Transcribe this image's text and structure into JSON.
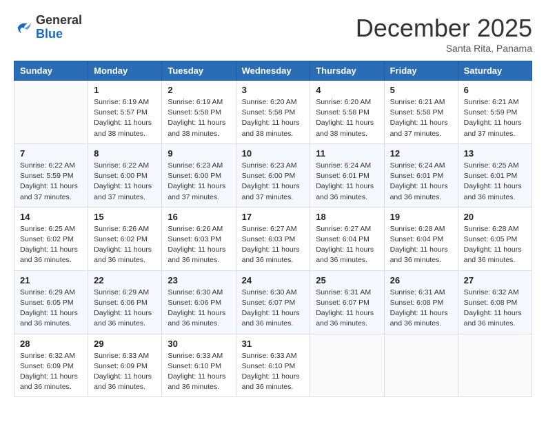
{
  "header": {
    "logo_line1": "General",
    "logo_line2": "Blue",
    "month_title": "December 2025",
    "subtitle": "Santa Rita, Panama"
  },
  "weekdays": [
    "Sunday",
    "Monday",
    "Tuesday",
    "Wednesday",
    "Thursday",
    "Friday",
    "Saturday"
  ],
  "weeks": [
    [
      {
        "day": "",
        "info": ""
      },
      {
        "day": "1",
        "info": "Sunrise: 6:19 AM\nSunset: 5:57 PM\nDaylight: 11 hours and 38 minutes."
      },
      {
        "day": "2",
        "info": "Sunrise: 6:19 AM\nSunset: 5:58 PM\nDaylight: 11 hours and 38 minutes."
      },
      {
        "day": "3",
        "info": "Sunrise: 6:20 AM\nSunset: 5:58 PM\nDaylight: 11 hours and 38 minutes."
      },
      {
        "day": "4",
        "info": "Sunrise: 6:20 AM\nSunset: 5:58 PM\nDaylight: 11 hours and 38 minutes."
      },
      {
        "day": "5",
        "info": "Sunrise: 6:21 AM\nSunset: 5:58 PM\nDaylight: 11 hours and 37 minutes."
      },
      {
        "day": "6",
        "info": "Sunrise: 6:21 AM\nSunset: 5:59 PM\nDaylight: 11 hours and 37 minutes."
      }
    ],
    [
      {
        "day": "7",
        "info": "Sunrise: 6:22 AM\nSunset: 5:59 PM\nDaylight: 11 hours and 37 minutes."
      },
      {
        "day": "8",
        "info": "Sunrise: 6:22 AM\nSunset: 6:00 PM\nDaylight: 11 hours and 37 minutes."
      },
      {
        "day": "9",
        "info": "Sunrise: 6:23 AM\nSunset: 6:00 PM\nDaylight: 11 hours and 37 minutes."
      },
      {
        "day": "10",
        "info": "Sunrise: 6:23 AM\nSunset: 6:00 PM\nDaylight: 11 hours and 37 minutes."
      },
      {
        "day": "11",
        "info": "Sunrise: 6:24 AM\nSunset: 6:01 PM\nDaylight: 11 hours and 36 minutes."
      },
      {
        "day": "12",
        "info": "Sunrise: 6:24 AM\nSunset: 6:01 PM\nDaylight: 11 hours and 36 minutes."
      },
      {
        "day": "13",
        "info": "Sunrise: 6:25 AM\nSunset: 6:01 PM\nDaylight: 11 hours and 36 minutes."
      }
    ],
    [
      {
        "day": "14",
        "info": "Sunrise: 6:25 AM\nSunset: 6:02 PM\nDaylight: 11 hours and 36 minutes."
      },
      {
        "day": "15",
        "info": "Sunrise: 6:26 AM\nSunset: 6:02 PM\nDaylight: 11 hours and 36 minutes."
      },
      {
        "day": "16",
        "info": "Sunrise: 6:26 AM\nSunset: 6:03 PM\nDaylight: 11 hours and 36 minutes."
      },
      {
        "day": "17",
        "info": "Sunrise: 6:27 AM\nSunset: 6:03 PM\nDaylight: 11 hours and 36 minutes."
      },
      {
        "day": "18",
        "info": "Sunrise: 6:27 AM\nSunset: 6:04 PM\nDaylight: 11 hours and 36 minutes."
      },
      {
        "day": "19",
        "info": "Sunrise: 6:28 AM\nSunset: 6:04 PM\nDaylight: 11 hours and 36 minutes."
      },
      {
        "day": "20",
        "info": "Sunrise: 6:28 AM\nSunset: 6:05 PM\nDaylight: 11 hours and 36 minutes."
      }
    ],
    [
      {
        "day": "21",
        "info": "Sunrise: 6:29 AM\nSunset: 6:05 PM\nDaylight: 11 hours and 36 minutes."
      },
      {
        "day": "22",
        "info": "Sunrise: 6:29 AM\nSunset: 6:06 PM\nDaylight: 11 hours and 36 minutes."
      },
      {
        "day": "23",
        "info": "Sunrise: 6:30 AM\nSunset: 6:06 PM\nDaylight: 11 hours and 36 minutes."
      },
      {
        "day": "24",
        "info": "Sunrise: 6:30 AM\nSunset: 6:07 PM\nDaylight: 11 hours and 36 minutes."
      },
      {
        "day": "25",
        "info": "Sunrise: 6:31 AM\nSunset: 6:07 PM\nDaylight: 11 hours and 36 minutes."
      },
      {
        "day": "26",
        "info": "Sunrise: 6:31 AM\nSunset: 6:08 PM\nDaylight: 11 hours and 36 minutes."
      },
      {
        "day": "27",
        "info": "Sunrise: 6:32 AM\nSunset: 6:08 PM\nDaylight: 11 hours and 36 minutes."
      }
    ],
    [
      {
        "day": "28",
        "info": "Sunrise: 6:32 AM\nSunset: 6:09 PM\nDaylight: 11 hours and 36 minutes."
      },
      {
        "day": "29",
        "info": "Sunrise: 6:33 AM\nSunset: 6:09 PM\nDaylight: 11 hours and 36 minutes."
      },
      {
        "day": "30",
        "info": "Sunrise: 6:33 AM\nSunset: 6:10 PM\nDaylight: 11 hours and 36 minutes."
      },
      {
        "day": "31",
        "info": "Sunrise: 6:33 AM\nSunset: 6:10 PM\nDaylight: 11 hours and 36 minutes."
      },
      {
        "day": "",
        "info": ""
      },
      {
        "day": "",
        "info": ""
      },
      {
        "day": "",
        "info": ""
      }
    ]
  ]
}
